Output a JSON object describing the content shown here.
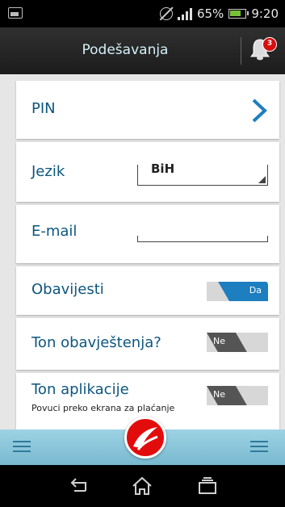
{
  "status_bar": {
    "battery_percent": "65%",
    "time": "9:20"
  },
  "header": {
    "title": "Podešavanja",
    "notification_count": "3"
  },
  "settings": {
    "pin": {
      "label": "PIN"
    },
    "language": {
      "label": "Jezik",
      "value": "BiH"
    },
    "email": {
      "label": "E-mail",
      "value": ""
    },
    "notifications": {
      "label": "Obavijesti",
      "toggle_label": "Da",
      "enabled": true
    },
    "notification_tone": {
      "label": "Ton obavještenja?",
      "toggle_label": "Ne",
      "enabled": false
    },
    "app_tone": {
      "label": "Ton aplikacije",
      "hint": "Povuci preko ekrana za plaćanje",
      "toggle_label": "Ne",
      "enabled": false
    }
  },
  "colors": {
    "accent": "#0d567e",
    "toggle_on": "#1d7ec0",
    "toggle_off": "#555555",
    "bottom_bar": "#8cc6dc",
    "logo_red": "#e30c0c"
  },
  "icons": {
    "left_menu": "hamburger-icon",
    "right_menu": "hamburger-icon",
    "logo": "bank-logo-icon",
    "bell": "bell-icon",
    "pin_arrow": "chevron-right-icon",
    "nav_back": "back-icon",
    "nav_home": "home-icon",
    "nav_recent": "recent-apps-icon"
  }
}
